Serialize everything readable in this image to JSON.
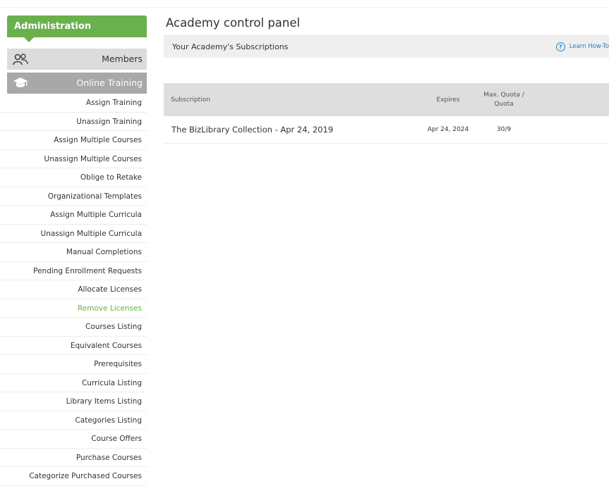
{
  "sidebar": {
    "header": "Administration",
    "members_label": "Members",
    "online_training_label": "Online Training",
    "items": [
      "Assign Training",
      "Unassign Training",
      "Assign Multiple Courses",
      "Unassign Multiple Courses",
      "Oblige to Retake",
      "Organizational Templates",
      "Assign Multiple Curricula",
      "Unassign Multiple Curricula",
      "Manual Completions",
      "Pending Enrollment Requests",
      "Allocate Licenses",
      "Remove Licenses",
      "Courses Listing",
      "Equivalent Courses",
      "Prerequisites",
      "Curricula Listing",
      "Library Items Listing",
      "Categories Listing",
      "Course Offers",
      "Purchase Courses",
      "Categorize Purchased Courses"
    ],
    "active_item": "Remove Licenses"
  },
  "main": {
    "title": "Academy control panel",
    "subscriptions_label": "Your Academy's Subscriptions",
    "learn_label": "Learn How-To",
    "table": {
      "headers": {
        "subscription": "Subscription",
        "expires": "Expires",
        "quota_line1": "Max. Quota /",
        "quota_line2": "Quota"
      },
      "rows": [
        {
          "subscription": "The BizLibrary Collection - Apr 24, 2019",
          "expires": "Apr 24, 2024",
          "quota": "30/9"
        }
      ]
    }
  },
  "colors": {
    "accent_green": "#6ab04c",
    "link_blue": "#2d7fbf",
    "section_gray": "#dcdcdc",
    "active_section_gray": "#a8a8a8"
  },
  "icons": {
    "members": "members-icon",
    "online_training": "graduation-cap-icon",
    "help": "help-circle-icon"
  }
}
